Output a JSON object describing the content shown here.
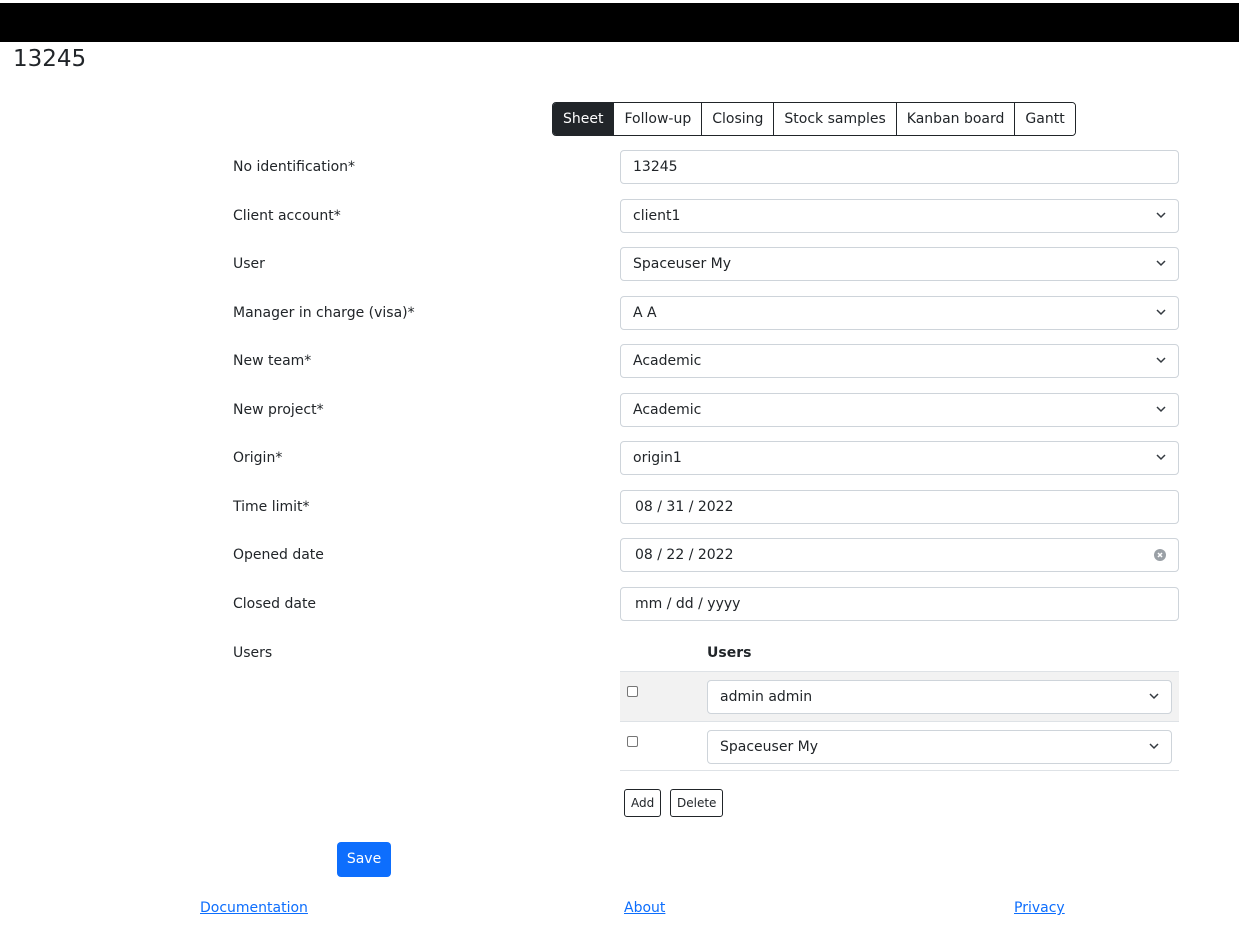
{
  "header": {
    "title": "13245"
  },
  "tabs": [
    {
      "label": "Sheet",
      "active": true
    },
    {
      "label": "Follow-up",
      "active": false
    },
    {
      "label": "Closing",
      "active": false
    },
    {
      "label": "Stock samples",
      "active": false
    },
    {
      "label": "Kanban board",
      "active": false
    },
    {
      "label": "Gantt",
      "active": false
    }
  ],
  "form": {
    "fields": [
      {
        "label": "No identification*",
        "value": "13245",
        "type": "text"
      },
      {
        "label": "Client account*",
        "value": "client1",
        "type": "select"
      },
      {
        "label": "User",
        "value": "Spaceuser My",
        "type": "select"
      },
      {
        "label": "Manager in charge (visa)*",
        "value": "A A",
        "type": "select"
      },
      {
        "label": "New team*",
        "value": "Academic",
        "type": "select"
      },
      {
        "label": "New project*",
        "value": "Academic",
        "type": "select"
      },
      {
        "label": "Origin*",
        "value": "origin1",
        "type": "select"
      },
      {
        "label": "Time limit*",
        "value": "08 / 31 / 2022",
        "type": "date"
      },
      {
        "label": "Opened date",
        "value": "08 / 22 / 2022",
        "type": "date-clearable"
      },
      {
        "label": "Closed date",
        "value": "mm / dd / yyyy",
        "type": "date"
      }
    ],
    "users": {
      "label": "Users",
      "column_header": "Users",
      "rows": [
        {
          "checked": false,
          "value": "admin admin"
        },
        {
          "checked": false,
          "value": "Spaceuser My"
        }
      ],
      "add_label": "Add",
      "delete_label": "Delete"
    },
    "save_label": "Save"
  },
  "footer": {
    "documentation": "Documentation",
    "about": "About",
    "privacy": "Privacy"
  },
  "colors": {
    "primary": "#0d6efd",
    "dark": "#212529"
  }
}
